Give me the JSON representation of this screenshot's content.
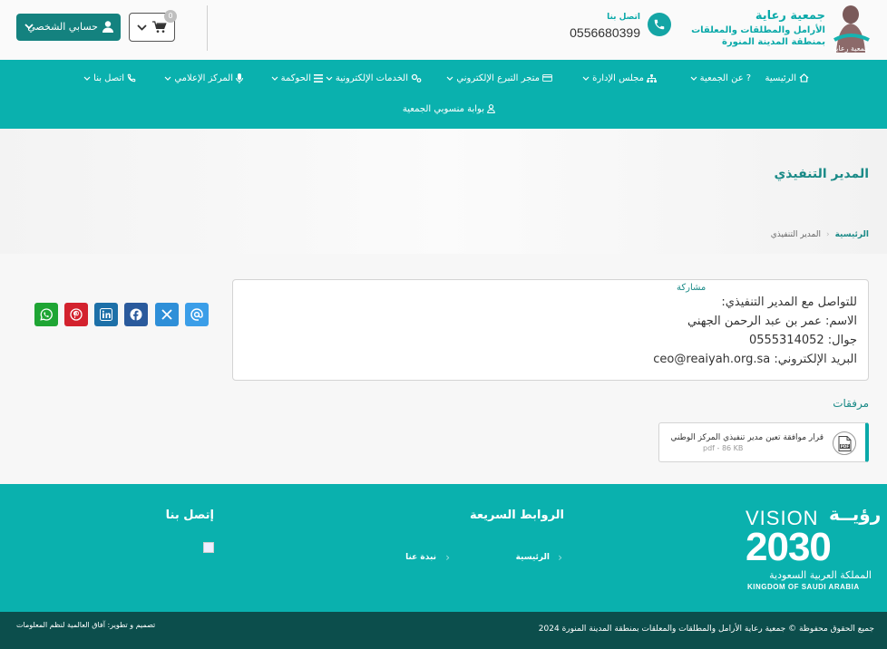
{
  "header": {
    "logo": {
      "mark_text": "جمعية رعاية",
      "title": "جمعية رعاية",
      "subtitle1": "الأرامل والمطلقات والمعلقات",
      "subtitle2": "بمنطقة المدينة المنورة"
    },
    "contact_label": "اتصل بنا",
    "contact_phone": "0556680399",
    "cart_count": "0",
    "account_label": "حسابي الشخصي"
  },
  "nav": {
    "items": [
      {
        "label": "الرئيسية",
        "icon": "home-icon"
      },
      {
        "label": "عن الجمعية",
        "icon": "question-icon"
      },
      {
        "label": "مجلس الإدارة",
        "icon": "sitemap-icon"
      },
      {
        "label": "متجر التبرع الإلكتروني",
        "icon": "credit-card-icon"
      },
      {
        "label": "الخدمات الإلكترونية",
        "icon": "cogs-icon"
      },
      {
        "label": "الحوكمة",
        "icon": "list-icon"
      },
      {
        "label": "المركز الإعلامي",
        "icon": "microphone-icon"
      },
      {
        "label": "اتصل بنا",
        "icon": "phone-icon"
      },
      {
        "label": "بوابة منسوبي الجمعية",
        "icon": "user-icon"
      }
    ]
  },
  "page": {
    "title": "المدير التنفيذي",
    "breadcrumb_home": "الرئيسية",
    "breadcrumb_current": "المدير التنفيذي"
  },
  "content": {
    "lines": [
      "للتواصل مع المدير التنفيذي:",
      "الاسم: عمر بن عبد الرحمن الجهني",
      "جوال: 0555314052",
      "البريد الإلكتروني: ceo@reaiyah.org.sa"
    ]
  },
  "share": {
    "label": "مشاركة",
    "buttons": [
      {
        "name": "email",
        "color": "#3b9ee8"
      },
      {
        "name": "x",
        "color": "#2e8fd8"
      },
      {
        "name": "facebook",
        "color": "#2a5a9c"
      },
      {
        "name": "linkedin",
        "color": "#1d70a8"
      },
      {
        "name": "pinterest",
        "color": "#d3222e"
      },
      {
        "name": "whatsapp",
        "color": "#1fa534"
      }
    ]
  },
  "attachments": {
    "title": "مرفقات",
    "items": [
      {
        "name": "قرار موافقة تعين مدير تنفيذي المركز الوطني",
        "meta": "pdf - 86 KB"
      }
    ]
  },
  "footer": {
    "vision_ar": "رؤيــة",
    "vision_en": "VISION",
    "vision_year": "2030",
    "vision_country_ar": "المملكة العربية السعودية",
    "vision_country_en": "KINGDOM OF SAUDI ARABIA",
    "quick_links_title": "الروابط السريعة",
    "quick_links": [
      "الرئيسية",
      "نبذة عنا"
    ],
    "contact_title": "إتصل بنا",
    "copyright": "جميع الحقوق محفوظة © جمعية رعاية الأرامل والمطلقات والمعلقات بمنطقة المدينة المنورة 2024",
    "credit": "تصميم و تطوير: آفاق العالمية لنظم المعلومات"
  },
  "colors": {
    "primary": "#0ab1ae",
    "dark": "#0c4e4c",
    "accent": "#1a8a87"
  }
}
